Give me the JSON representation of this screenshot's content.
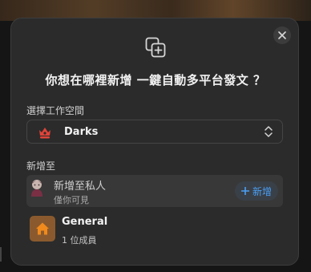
{
  "dialog": {
    "title": "你想在哪裡新增 一鍵自動多平台發文 ？",
    "close_label": "×",
    "icon": "add-copy-icon"
  },
  "workspace": {
    "label": "選擇工作空間",
    "selected": "Darks",
    "icon": "crown-icon",
    "accent": "#e0443a"
  },
  "destinations": {
    "label": "新增至",
    "items": [
      {
        "title": "新增至私人",
        "subtitle": "僅你可見",
        "action_label": "新增",
        "icon": "avatar"
      },
      {
        "title": "General",
        "subtitle": "1 位成員",
        "icon": "home-icon",
        "color": "#8a5a2e"
      }
    ]
  },
  "colors": {
    "modal_bg": "#2b2b2b",
    "accent_blue": "#4a9ff5"
  }
}
